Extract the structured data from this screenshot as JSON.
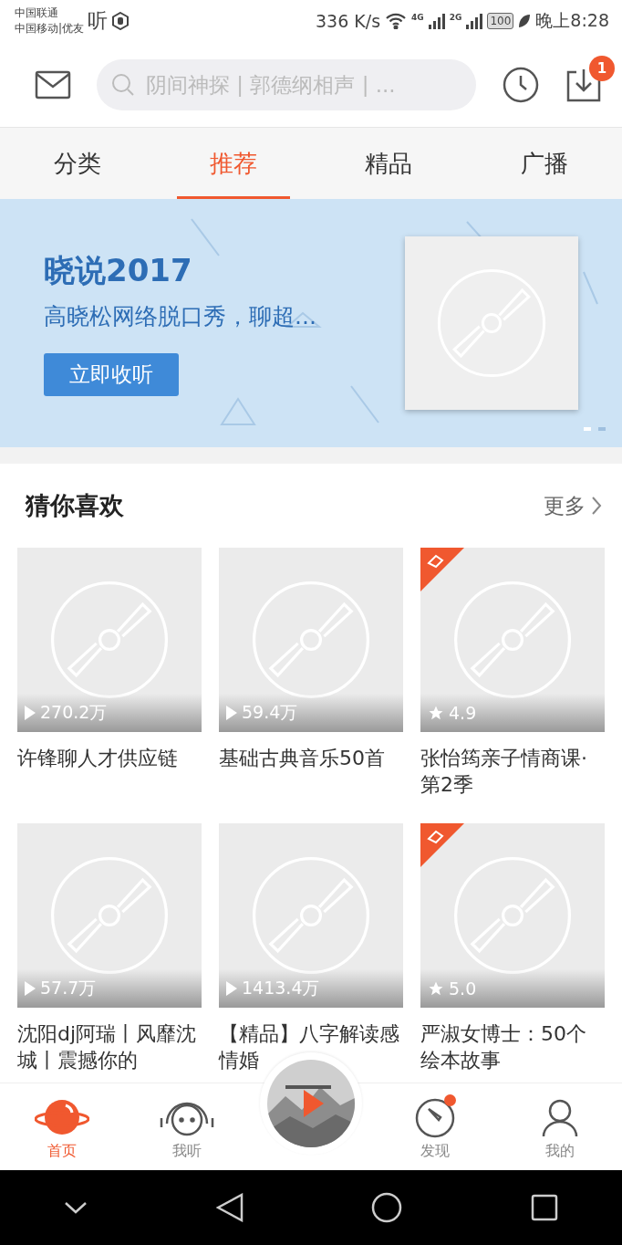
{
  "status_bar": {
    "carrier_1": "中国联通",
    "carrier_2": "中国移动|优友",
    "app_glyph": "听",
    "speed": "336 K/s",
    "net_1": "4G",
    "net_2": "2G",
    "battery": "100",
    "time": "晚上8:28"
  },
  "header": {
    "search": {
      "placeholder": "阴间神探 | 郭德纲相声 | ..."
    },
    "download_badge": "1"
  },
  "tabs": [
    {
      "label": "分类",
      "selected": false
    },
    {
      "label": "推荐",
      "selected": true
    },
    {
      "label": "精品",
      "selected": false
    },
    {
      "label": "广播",
      "selected": false
    }
  ],
  "banner": {
    "title": "晓说2017",
    "subtitle": "高晓松网络脱口秀，聊超...",
    "button": "立即收听",
    "dots": [
      {
        "selected": true
      },
      {
        "selected": false
      }
    ]
  },
  "section": {
    "title": "猜你喜欢",
    "more": "更多"
  },
  "cards": [
    {
      "kind": "plays",
      "stat": "270.2万",
      "title": "许锋聊人才供应链",
      "badge": false
    },
    {
      "kind": "plays",
      "stat": "59.4万",
      "title": "基础古典音乐50首",
      "badge": false
    },
    {
      "kind": "rating",
      "stat": "4.9",
      "title": "张怡筠亲子情商课·第2季",
      "badge": true
    },
    {
      "kind": "plays",
      "stat": "57.7万",
      "title": "沈阳dj阿瑞丨风靡沈城丨震撼你的",
      "badge": false
    },
    {
      "kind": "plays",
      "stat": "1413.4万",
      "title": "【精品】八字解读感情婚",
      "badge": false
    },
    {
      "kind": "rating",
      "stat": "5.0",
      "title": "严淑女博士：50个绘本故事",
      "badge": true
    }
  ],
  "bottom_nav": [
    {
      "kind": "home",
      "label": "首页",
      "selected": true,
      "dot": false
    },
    {
      "kind": "listen",
      "label": "我听",
      "selected": false,
      "dot": false
    },
    {
      "kind": "discover",
      "label": "发现",
      "selected": false,
      "dot": true
    },
    {
      "kind": "me",
      "label": "我的",
      "selected": false,
      "dot": false
    }
  ]
}
